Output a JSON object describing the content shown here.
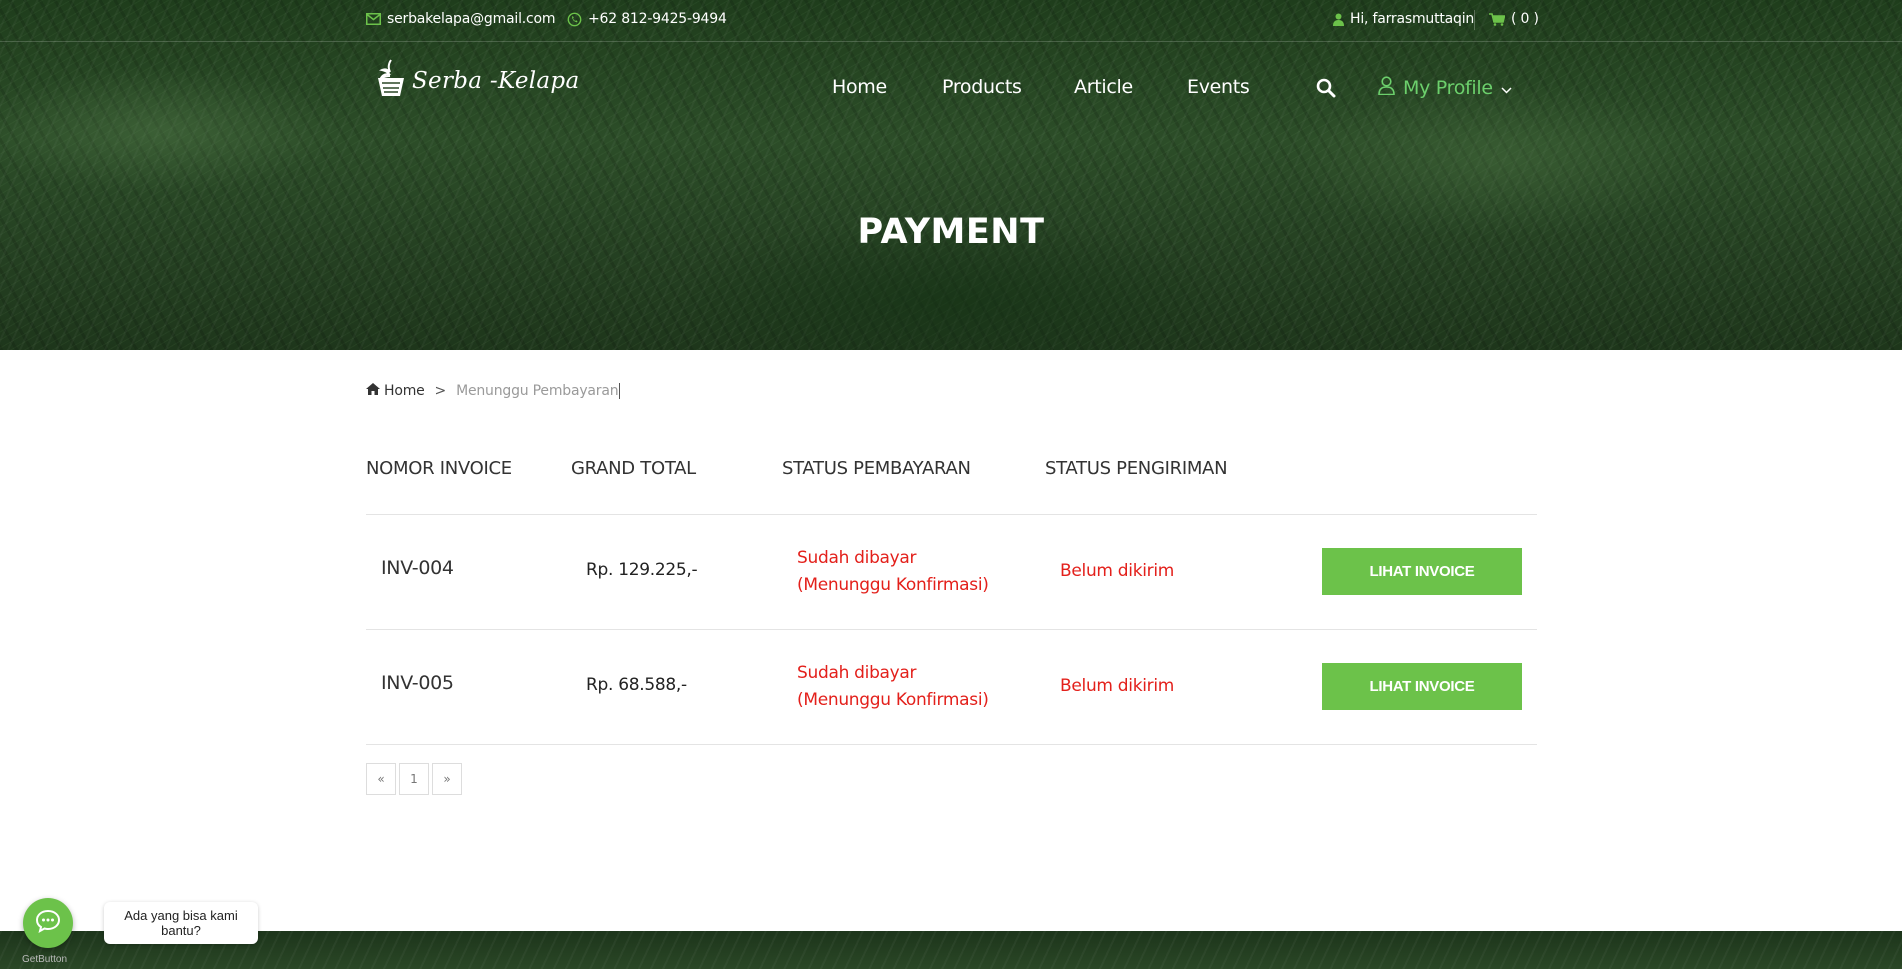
{
  "topbar": {
    "email": "serbakelapa@gmail.com",
    "phone": "+62 812-9425-9494",
    "greeting": "Hi, farrasmuttaqin",
    "cart": "( 0 )"
  },
  "brand": {
    "logo_text": "Serba -Kelapa"
  },
  "nav": {
    "items": [
      {
        "label": "Home"
      },
      {
        "label": "Products"
      },
      {
        "label": "Article"
      },
      {
        "label": "Events"
      }
    ],
    "profile_label": "My Profile"
  },
  "hero": {
    "title": "PAYMENT"
  },
  "breadcrumb": {
    "home": "Home",
    "separator": ">",
    "current": "Menunggu Pembayaran"
  },
  "table": {
    "headers": [
      "NOMOR INVOICE",
      "GRAND TOTAL",
      "STATUS PEMBAYARAN",
      "STATUS PENGIRIMAN"
    ],
    "rows": [
      {
        "invoice": "INV-004",
        "total": "Rp. 129.225,-",
        "payment_line1": "Sudah dibayar",
        "payment_line2": "(Menunggu Konfirmasi)",
        "shipping": "Belum dikirim",
        "action": "LIHAT INVOICE"
      },
      {
        "invoice": "INV-005",
        "total": "Rp. 68.588,-",
        "payment_line1": "Sudah dibayar",
        "payment_line2": "(Menunggu Konfirmasi)",
        "shipping": "Belum dikirim",
        "action": "LIHAT INVOICE"
      }
    ]
  },
  "pagination": {
    "prev": "«",
    "page": "1",
    "next": "»"
  },
  "chat_widget": {
    "bubble_text": "Ada yang bisa kami bantu?",
    "brand": "GetButton"
  },
  "colors": {
    "accent": "#6cc24a",
    "status_red": "#e3201b",
    "profile_green": "#6cd06c"
  }
}
